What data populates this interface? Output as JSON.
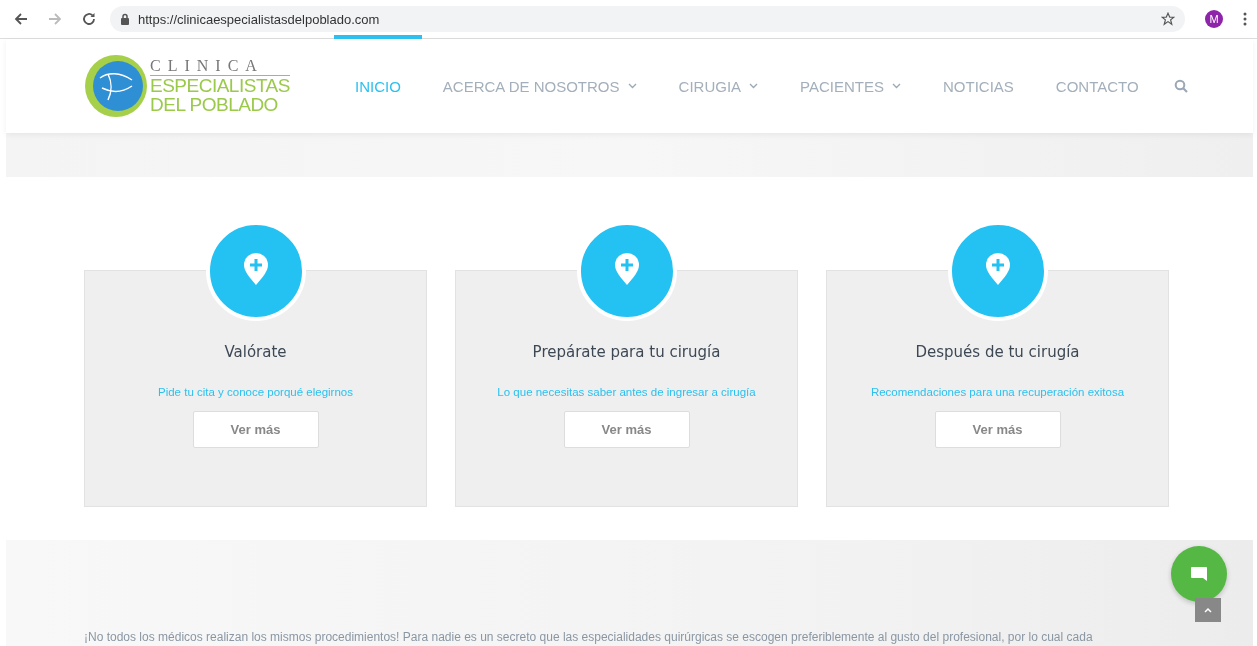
{
  "browser": {
    "url": "https://clinicaespecialistasdelpoblado.com",
    "profile_initial": "M"
  },
  "logo": {
    "line_1": "CLINICA",
    "line_2": "ESPECIALISTAS",
    "line_3": "DEL POBLADO"
  },
  "nav": [
    {
      "label": "INICIO",
      "selected": true,
      "dropdown": false
    },
    {
      "label": "ACERCA DE NOSOTROS",
      "selected": false,
      "dropdown": true
    },
    {
      "label": "CIRUGIA",
      "selected": false,
      "dropdown": true
    },
    {
      "label": "PACIENTES",
      "selected": false,
      "dropdown": true
    },
    {
      "label": "NOTICIAS",
      "selected": false,
      "dropdown": false
    },
    {
      "label": "CONTACTO",
      "selected": false,
      "dropdown": false
    }
  ],
  "cards": [
    {
      "title": "Valórate",
      "subtitle": "Pide tu cita y conoce porqué elegirnos",
      "button": "Ver más"
    },
    {
      "title": "Prepárate para tu cirugía",
      "subtitle": "Lo que necesitas saber antes de ingresar a cirugía",
      "button": "Ver más"
    },
    {
      "title": "Después de tu cirugía",
      "subtitle": "Recomendaciones para una recuperación exitosa",
      "button": "Ver más"
    }
  ],
  "intro": "¡No todos los médicos realizan los mismos procedimientos! Para nadie es un secreto que las especialidades quirúrgicas se escogen preferiblemente al gusto del profesional, por lo cual cada"
}
